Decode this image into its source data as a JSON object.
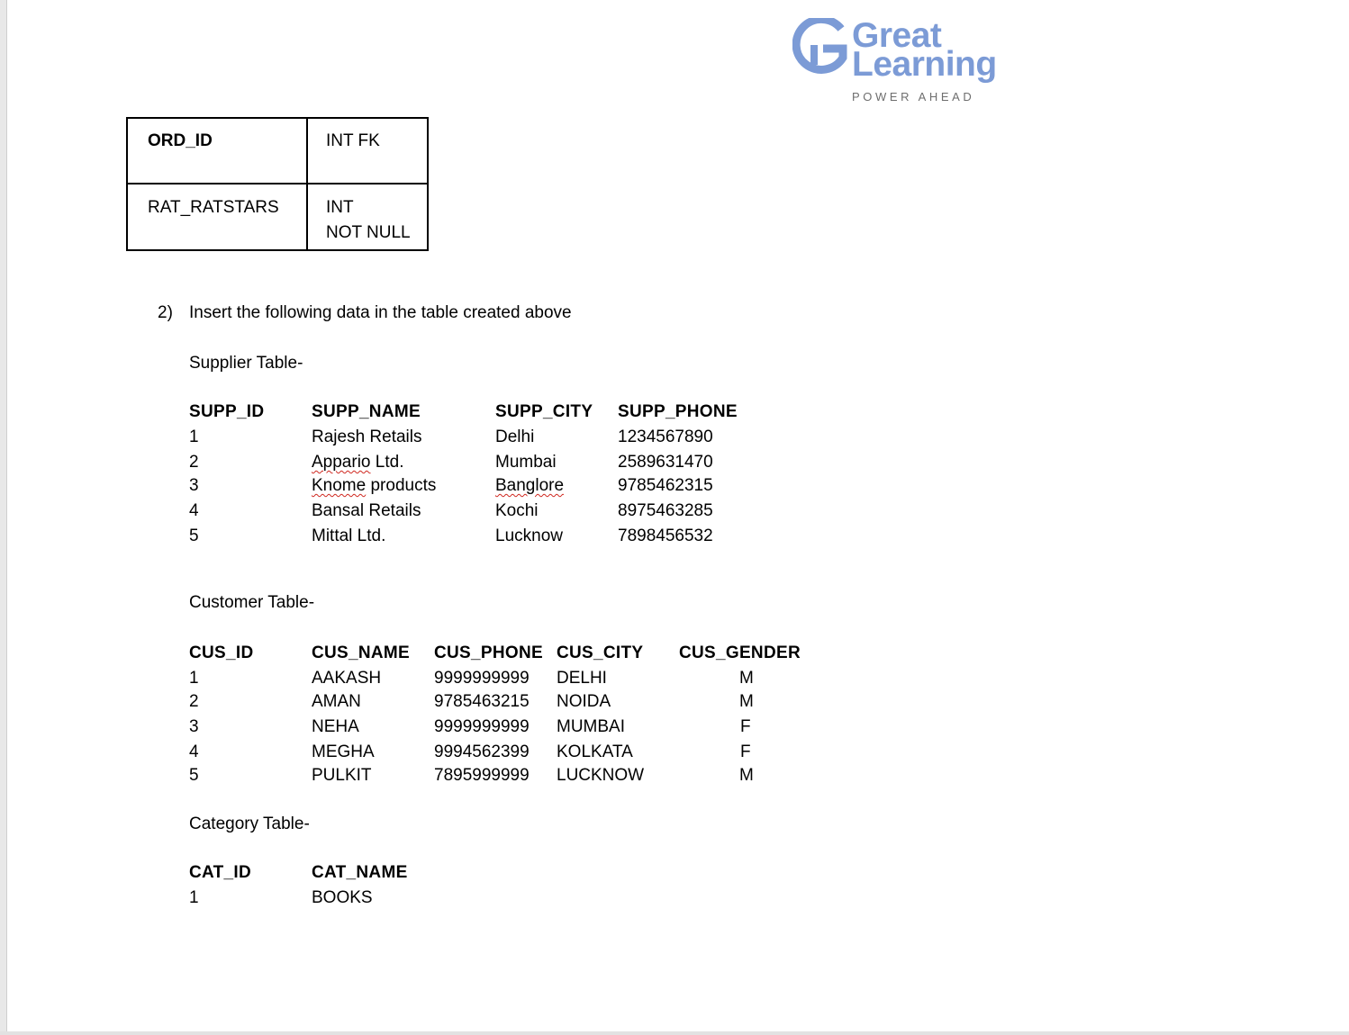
{
  "logo": {
    "word1": "Great",
    "word2": "Learning",
    "tagline": "POWER AHEAD",
    "icon": "great-learning-g-logo",
    "color": "#7c9bd6"
  },
  "schema_table": {
    "rows": [
      {
        "field": "ORD_ID",
        "type_line1": "INT FK",
        "type_line2": ""
      },
      {
        "field": "RAT_RATSTARS",
        "type_line1": "INT",
        "type_line2": "NOT NULL"
      }
    ]
  },
  "instruction": {
    "number": "2)",
    "text": "Insert the following data in the table created above"
  },
  "supplier": {
    "title": "Supplier Table-",
    "headers": [
      "SUPP_ID",
      "SUPP_NAME",
      "SUPP_CITY",
      "SUPP_PHONE"
    ],
    "rows": [
      [
        "1",
        "Rajesh Retails",
        "Delhi",
        "1234567890"
      ],
      [
        "2",
        "Appario Ltd.",
        "Mumbai",
        "2589631470"
      ],
      [
        "3",
        "Knome products",
        "Banglore",
        "9785462315"
      ],
      [
        "4",
        "Bansal Retails",
        "Kochi",
        "8975463285"
      ],
      [
        "5",
        "Mittal Ltd.",
        "Lucknow",
        "7898456532"
      ]
    ]
  },
  "customer": {
    "title": "Customer Table-",
    "headers": [
      "CUS_ID",
      "CUS_NAME",
      "CUS_PHONE",
      "CUS_CITY",
      "CUS_GENDER"
    ],
    "rows": [
      [
        "1",
        "AAKASH",
        "9999999999",
        "DELHI",
        "M"
      ],
      [
        "2",
        "AMAN",
        "9785463215",
        "NOIDA",
        "M"
      ],
      [
        "3",
        "NEHA",
        "9999999999",
        "MUMBAI",
        "F"
      ],
      [
        "4",
        "MEGHA",
        "9994562399",
        "KOLKATA",
        "F"
      ],
      [
        "5",
        "PULKIT",
        "7895999999",
        "LUCKNOW",
        "M"
      ]
    ]
  },
  "category": {
    "title": "Category Table-",
    "headers": [
      "CAT_ID",
      "CAT_NAME"
    ],
    "rows": [
      [
        "1",
        "BOOKS"
      ]
    ]
  }
}
